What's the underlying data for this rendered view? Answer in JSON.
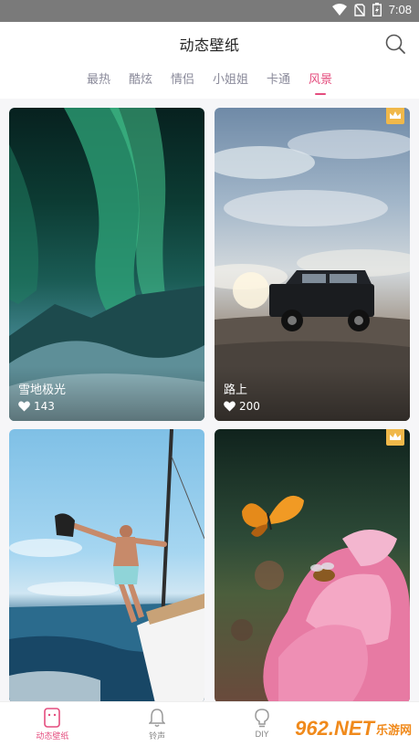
{
  "status_bar": {
    "time": "7:08"
  },
  "header": {
    "title": "动态壁纸"
  },
  "tabs": [
    {
      "label": "最热"
    },
    {
      "label": "酷炫"
    },
    {
      "label": "情侣"
    },
    {
      "label": "小姐姐"
    },
    {
      "label": "卡通"
    },
    {
      "label": "风景",
      "active": true
    }
  ],
  "cards": [
    {
      "title": "雪地极光",
      "likes": "143"
    },
    {
      "title": "路上",
      "likes": "200",
      "premium": true
    },
    {
      "title": "",
      "likes": ""
    },
    {
      "title": "",
      "likes": "",
      "premium": true
    }
  ],
  "bottom_nav": [
    {
      "label": "动态壁纸",
      "active": true
    },
    {
      "label": "铃声"
    },
    {
      "label": "DIY"
    },
    {
      "label": ""
    }
  ],
  "watermark": {
    "brand": "962.NET",
    "sub": "乐游网"
  },
  "colors": {
    "accent": "#e44d7e",
    "crown": "#f0b84a",
    "tab_inactive": "#8a8a9a"
  }
}
